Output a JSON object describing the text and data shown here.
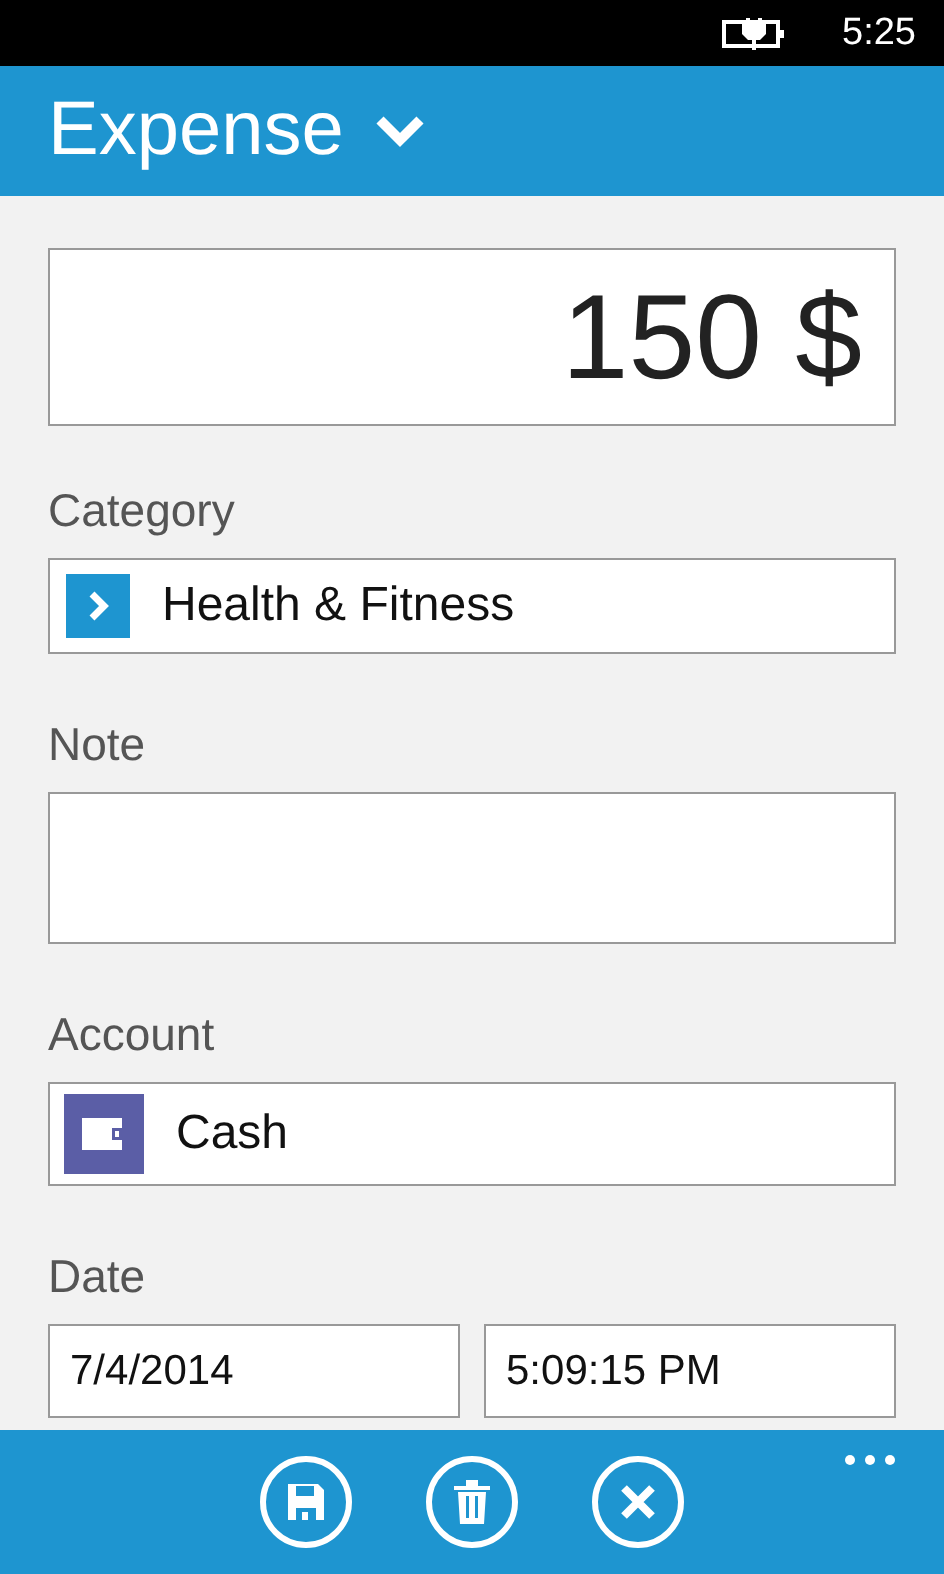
{
  "status_bar": {
    "time": "5:25"
  },
  "header": {
    "title": "Expense"
  },
  "amount": {
    "value": "150 $"
  },
  "category": {
    "label": "Category",
    "value": "Health & Fitness"
  },
  "note": {
    "label": "Note"
  },
  "account": {
    "label": "Account",
    "value": "Cash"
  },
  "date": {
    "label": "Date",
    "date": "7/4/2014",
    "time": "5:09:15 PM"
  },
  "app_bar": {
    "buttons": [
      {
        "kind": "save"
      },
      {
        "kind": "delete"
      },
      {
        "kind": "cancel"
      }
    ]
  }
}
